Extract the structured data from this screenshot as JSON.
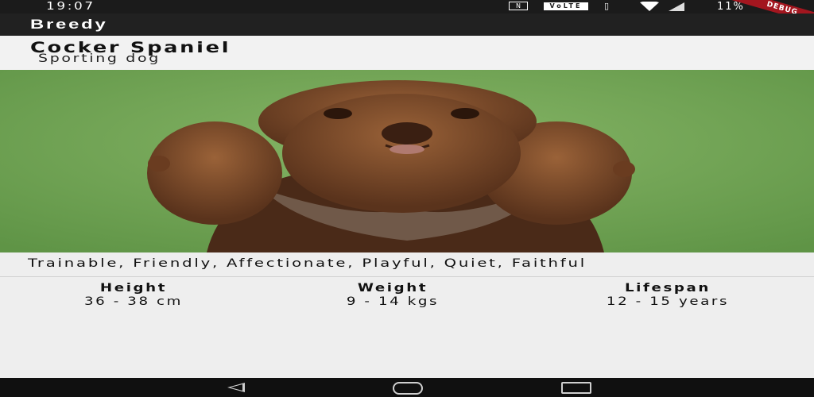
{
  "status_bar": {
    "time": "19:07",
    "nfc_icon": "nfc-icon",
    "volte": "VoLTE",
    "vibrate_icon": "vibrate-icon",
    "wifi_icon": "wifi-icon",
    "signal_icon": "signal-icon",
    "battery": "11%"
  },
  "debug_banner": "DEBUG",
  "app_bar": {
    "title": "Breedy"
  },
  "breed": {
    "name": "Cocker Spaniel",
    "group": "Sporting dog",
    "temperament": "Trainable, Friendly, Affectionate, Playful, Quiet, Faithful",
    "stats": [
      {
        "label": "Height",
        "value": "36 - 38 cm"
      },
      {
        "label": "Weight",
        "value": "9 - 14 kgs"
      },
      {
        "label": "Lifespan",
        "value": "12 - 15 years"
      }
    ]
  },
  "nav_bar": {
    "back_icon": "back-triangle-icon",
    "home_icon": "home-pill-icon",
    "recents_icon": "recents-square-icon"
  },
  "colors": {
    "status_bar_bg": "#1b1b1b",
    "app_bar_bg": "#212121",
    "photo_background": "#77a55a",
    "dog_fur": "#7a4a2a",
    "debug_banner": "#a3161f",
    "page_bg": "#eeeeee"
  }
}
